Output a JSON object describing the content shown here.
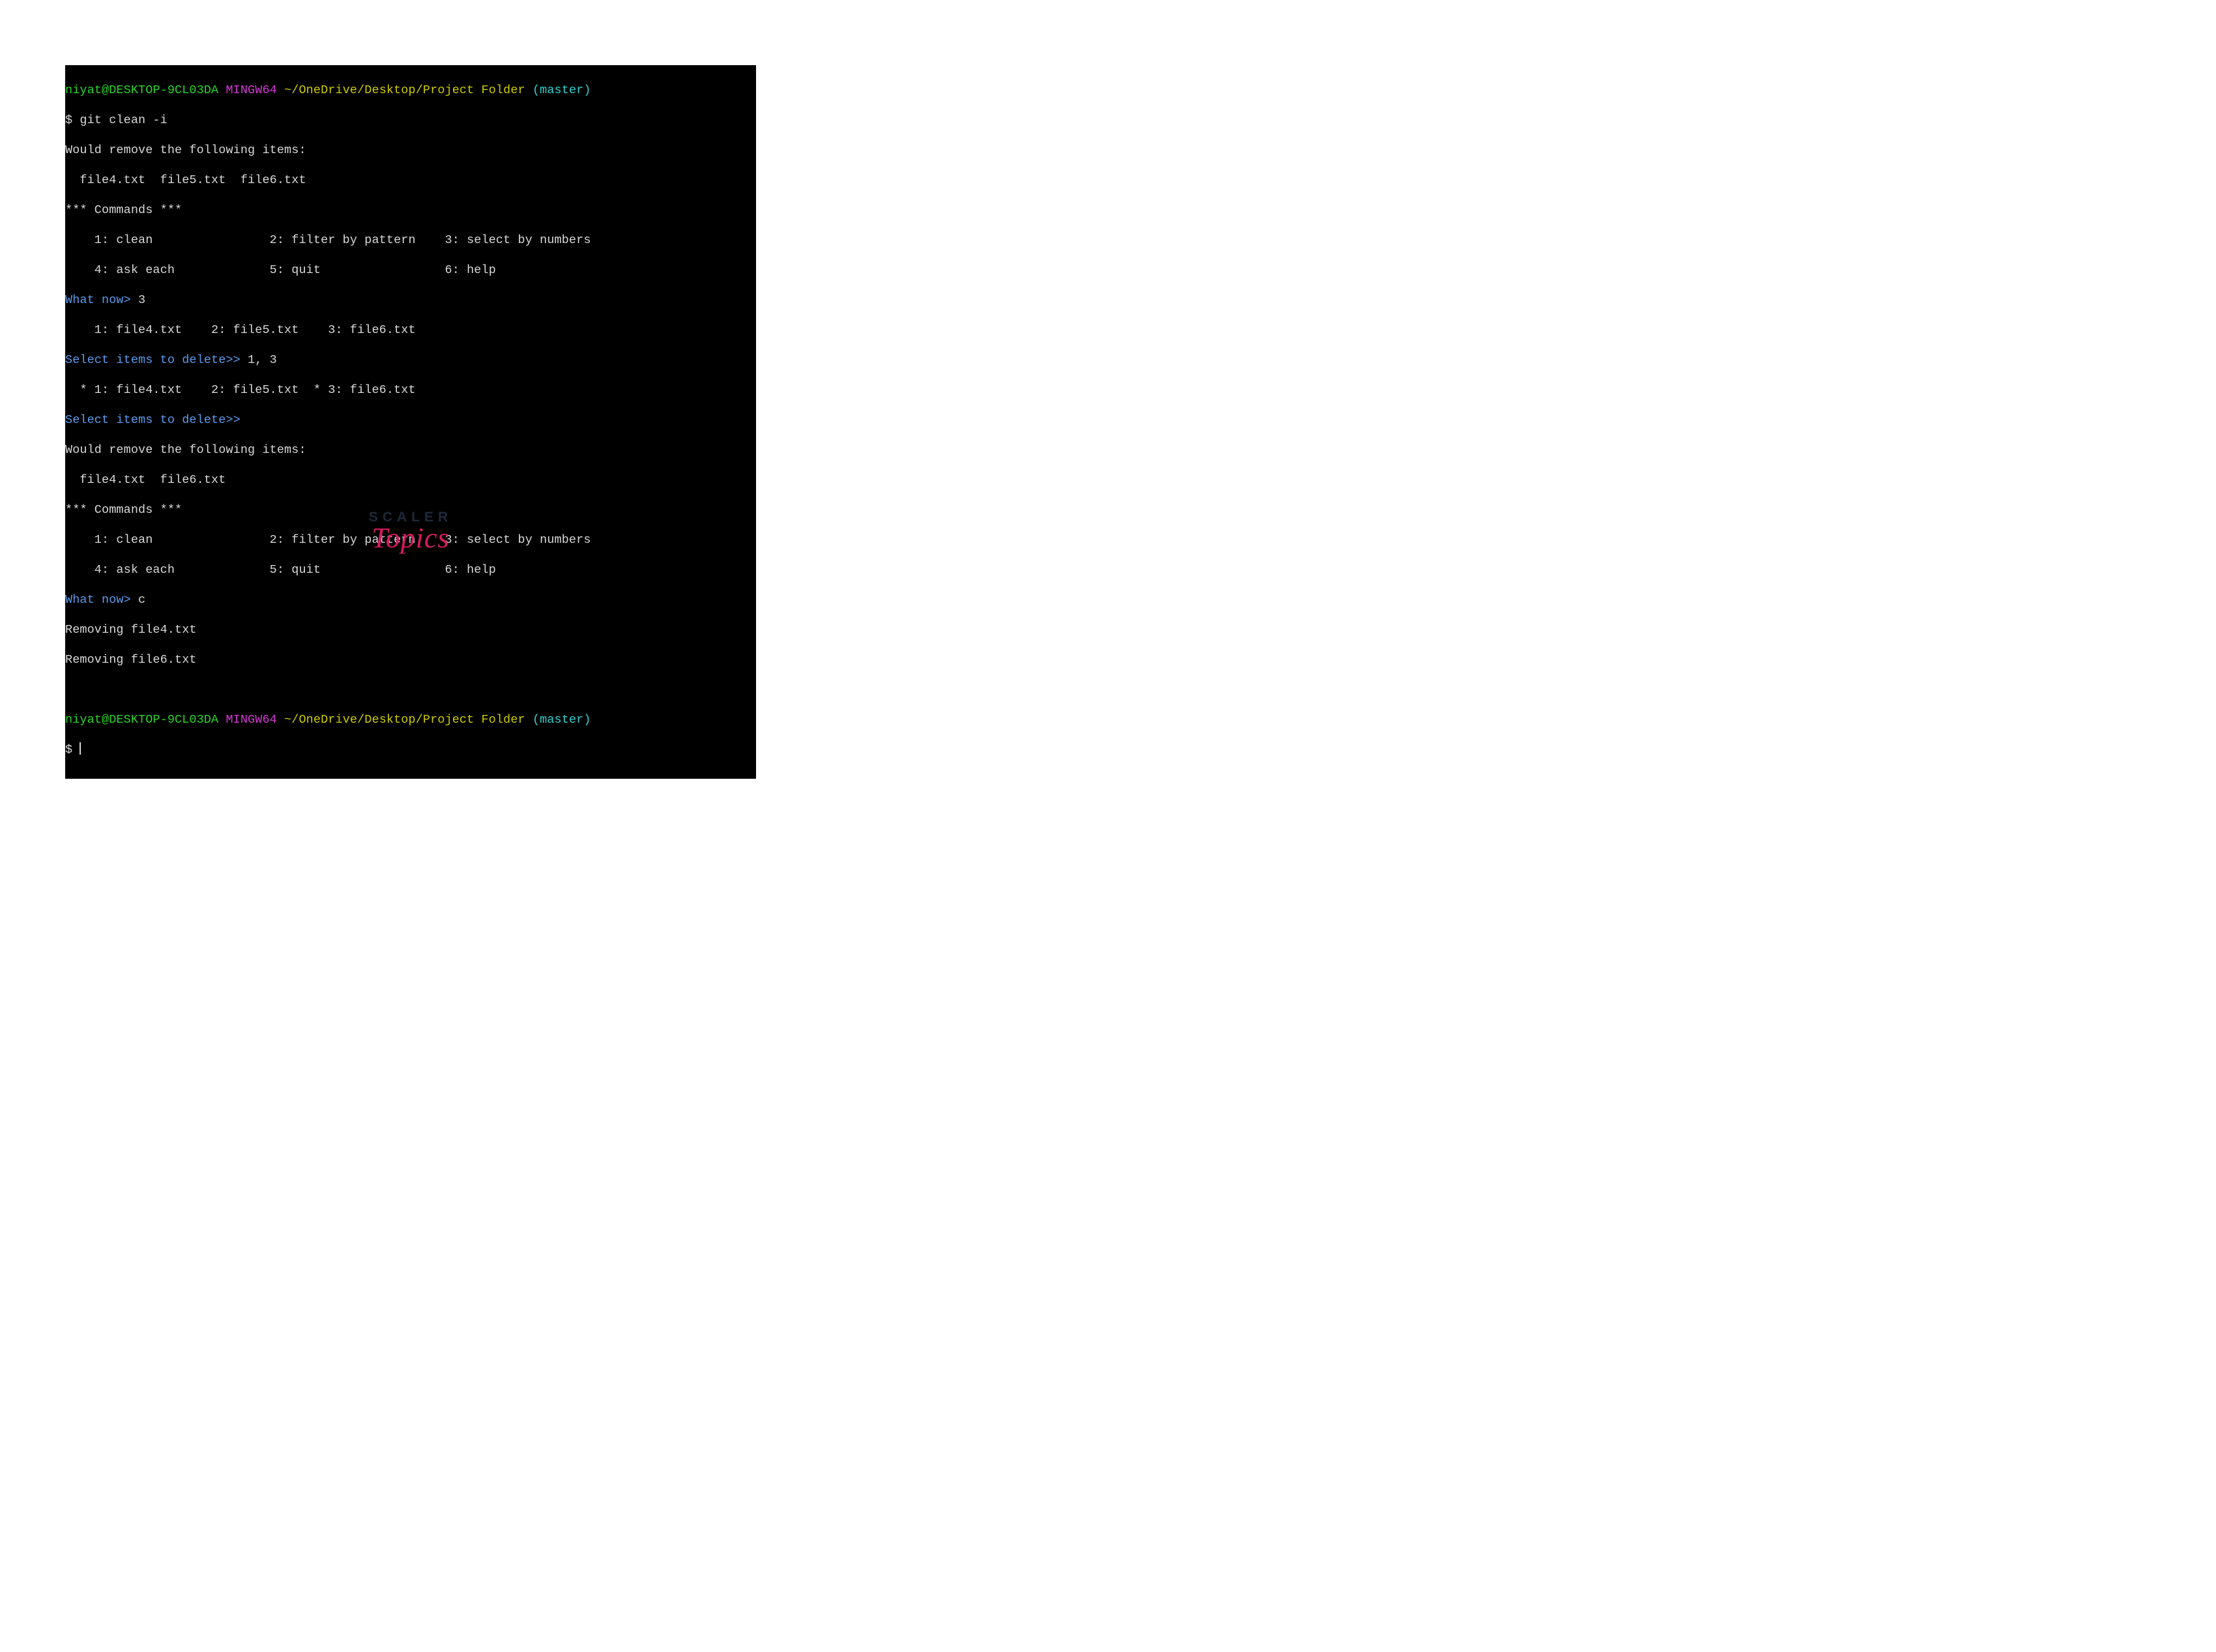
{
  "prompt1": {
    "user": "niyat@DESKTOP-9CL03DA",
    "shell": " MINGW64 ",
    "path": "~/OneDrive/Desktop/Project Folder",
    "branch": " (master)"
  },
  "cmd1": "$ git clean -i",
  "would_remove_1": "Would remove the following items:",
  "files_1": "  file4.txt  file5.txt  file6.txt",
  "cmds_hdr_1": "*** Commands ***",
  "menu_row1": "    1: clean                2: filter by pattern    3: select by numbers",
  "menu_row2": "    4: ask each             5: quit                 6: help",
  "what_now_1p": "What now> ",
  "what_now_1a": "3",
  "list_numbered": "    1: file4.txt    2: file5.txt    3: file6.txt",
  "select_1p": "Select items to delete>> ",
  "select_1a": "1, 3",
  "list_starred": "  * 1: file4.txt    2: file5.txt  * 3: file6.txt",
  "select_2p": "Select items to delete>> ",
  "would_remove_2": "Would remove the following items:",
  "files_2": "  file4.txt  file6.txt",
  "cmds_hdr_2": "*** Commands ***",
  "menu2_row1": "    1: clean                2: filter by pattern    3: select by numbers",
  "menu2_row2": "    4: ask each             5: quit                 6: help",
  "what_now_2p": "What now> ",
  "what_now_2a": "c",
  "removing1": "Removing file4.txt",
  "removing2": "Removing file6.txt",
  "blank": " ",
  "prompt2": {
    "user": "niyat@DESKTOP-9CL03DA",
    "shell": " MINGW64 ",
    "path": "~/OneDrive/Desktop/Project Folder",
    "branch": " (master)"
  },
  "cmd2": "$ ",
  "logo": {
    "line1": "SCALER",
    "line2": "Topics"
  }
}
